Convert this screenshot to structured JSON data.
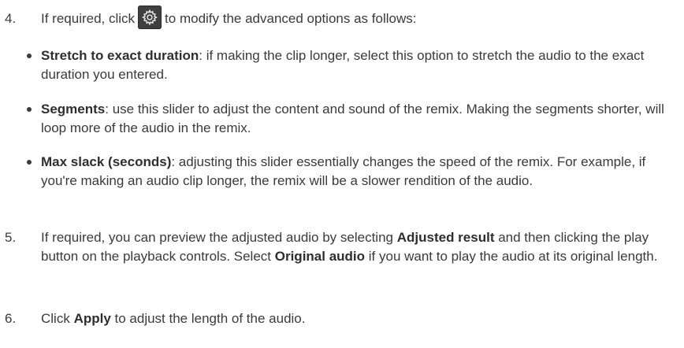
{
  "step4": {
    "number": "4.",
    "before_icon": "If required, click",
    "icon": "gear-icon",
    "after_icon": "to modify the advanced options as follows:"
  },
  "bullets": [
    {
      "term": "Stretch to exact duration",
      "desc": ": if making the clip longer, select this option to stretch the audio to the exact duration you entered."
    },
    {
      "term": "Segments",
      "desc": ": use this slider to adjust the content and sound of the remix. Making the segments shorter, will loop more of the audio in the remix."
    },
    {
      "term": "Max slack (seconds)",
      "desc": ": adjusting this slider essentially changes the speed of the remix. For example, if you're making an audio clip longer, the remix will be a slower rendition of the audio."
    }
  ],
  "step5": {
    "number": "5.",
    "part1": "If required, you can preview the adjusted audio by selecting ",
    "bold1": "Adjusted result",
    "part2": " and then clicking the play button on the playback controls. Select ",
    "bold2": "Original audio",
    "part3": " if you want to play the audio at its original length."
  },
  "step6": {
    "number": "6.",
    "part1": "Click ",
    "bold1": "Apply",
    "part2": " to adjust the length of the audio."
  }
}
